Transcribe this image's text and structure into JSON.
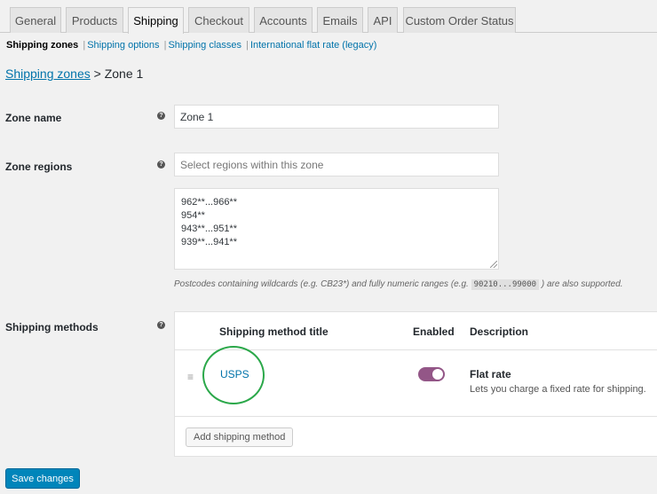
{
  "tabs": [
    {
      "label": "General"
    },
    {
      "label": "Products"
    },
    {
      "label": "Shipping"
    },
    {
      "label": "Checkout"
    },
    {
      "label": "Accounts"
    },
    {
      "label": "Emails"
    },
    {
      "label": "API"
    },
    {
      "label": "Custom Order Status"
    }
  ],
  "subnav": {
    "current": "Shipping zones",
    "links": [
      "Shipping options",
      "Shipping classes",
      "International flat rate (legacy)"
    ],
    "separator": "|"
  },
  "heading": {
    "link": "Shipping zones",
    "separator": ">",
    "current": "Zone 1"
  },
  "zone_name": {
    "label": "Zone name",
    "value": "Zone 1"
  },
  "zone_regions": {
    "label": "Zone regions",
    "placeholder": "Select regions within this zone",
    "postcodes": [
      "962**...966**",
      "954**",
      "943**...951**",
      "939**...941**"
    ],
    "hint_prefix": "Postcodes containing wildcards (e.g. CB23*) and fully numeric ranges (e.g.",
    "hint_code": "90210...99000",
    "hint_suffix": ") are also supported."
  },
  "shipping_methods": {
    "label": "Shipping methods",
    "columns": {
      "title": "Shipping method title",
      "enabled": "Enabled",
      "description": "Description"
    },
    "rows": [
      {
        "title": "USPS",
        "enabled": true,
        "desc_title": "Flat rate",
        "desc_text": "Lets you charge a fixed rate for shipping."
      }
    ],
    "add_button": "Add shipping method"
  },
  "help_glyph": "?",
  "save_button": "Save changes",
  "colors": {
    "link": "#0073aa",
    "toggle_on": "#935687",
    "primary_button": "#0085ba",
    "annotation_circle": "#2ba84a"
  }
}
